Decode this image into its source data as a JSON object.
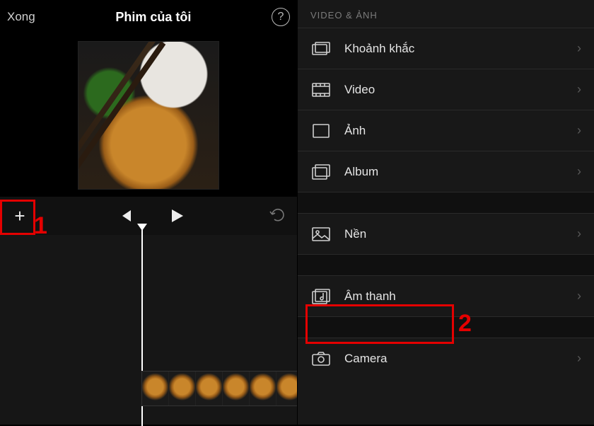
{
  "left_panel": {
    "done_label": "Xong",
    "title": "Phim của tôi",
    "help_tooltip": "?",
    "controls": {
      "add": "+",
      "prev": "previous",
      "play": "play",
      "undo": "undo"
    }
  },
  "right_panel": {
    "section_header": "VIDEO & ẢNH",
    "items_primary": [
      {
        "icon": "moments",
        "label": "Khoảnh khắc"
      },
      {
        "icon": "video",
        "label": "Video"
      },
      {
        "icon": "photo",
        "label": "Ảnh"
      },
      {
        "icon": "album",
        "label": "Album"
      }
    ],
    "items_secondary": [
      {
        "icon": "background",
        "label": "Nền"
      }
    ],
    "items_tertiary": [
      {
        "icon": "audio",
        "label": "Âm thanh"
      }
    ],
    "items_last": [
      {
        "icon": "camera",
        "label": "Camera"
      }
    ]
  },
  "annotations": {
    "step1": "1",
    "step2": "2"
  }
}
